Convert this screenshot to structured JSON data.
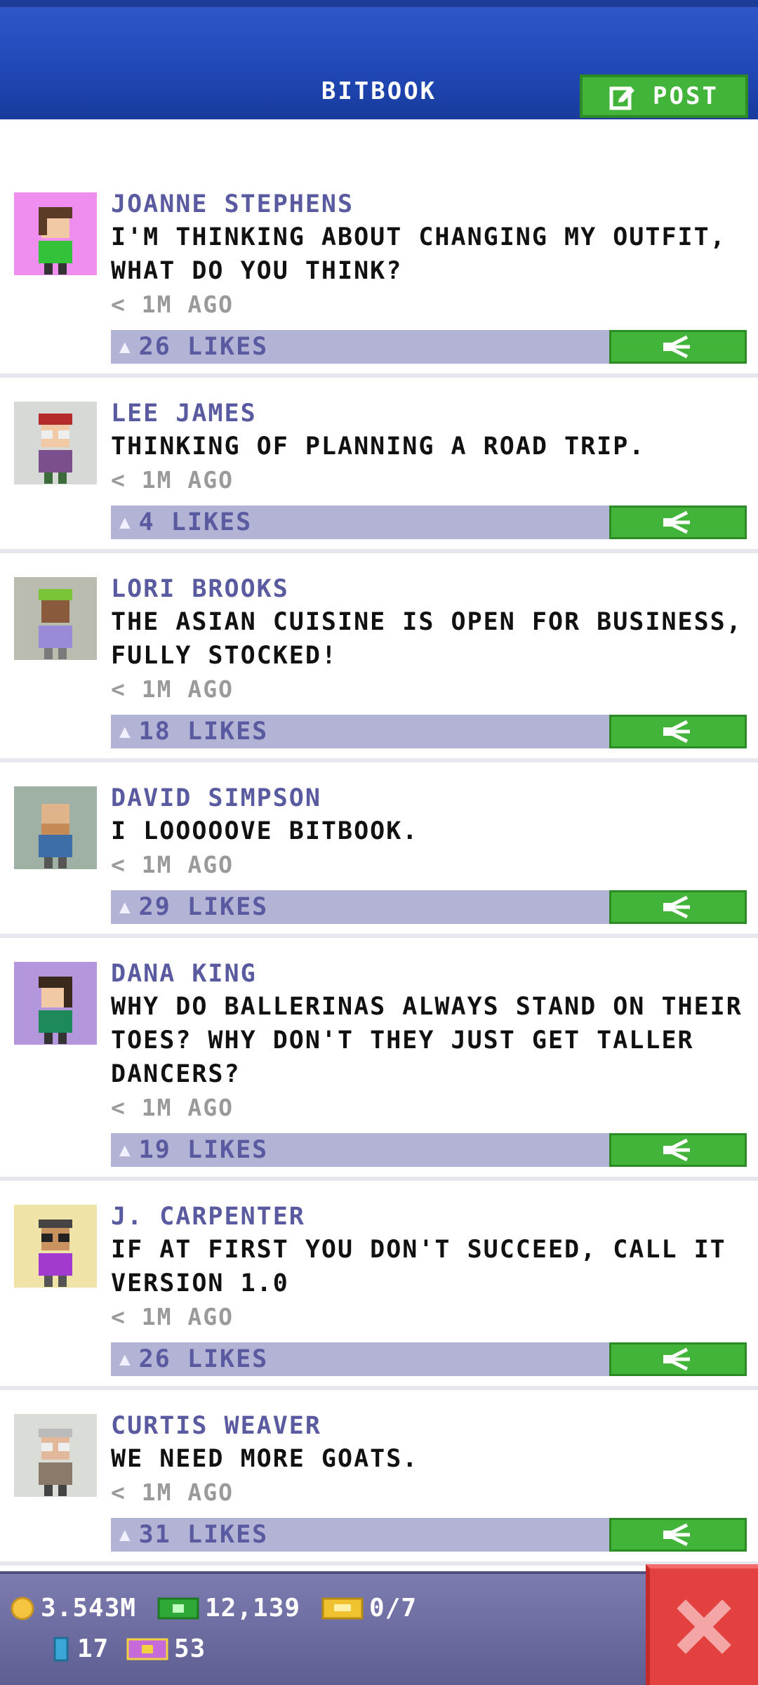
{
  "header": {
    "title": "BITBOOK",
    "post_label": "POST"
  },
  "posts": [
    {
      "name": "JOANNE STEPHENS",
      "message": "I'M THINKING ABOUT CHANGING MY OUTFIT, WHAT DO YOU THINK?",
      "time": "< 1M AGO",
      "likes": "26 LIKES"
    },
    {
      "name": "LEE JAMES",
      "message": "THINKING OF PLANNING A ROAD TRIP.",
      "time": "< 1M AGO",
      "likes": "4 LIKES"
    },
    {
      "name": "LORI BROOKS",
      "message": "THE ASIAN CUISINE IS OPEN FOR BUSINESS, FULLY STOCKED!",
      "time": "< 1M AGO",
      "likes": "18 LIKES"
    },
    {
      "name": "DAVID SIMPSON",
      "message": "I LOOOOOVE BITBOOK.",
      "time": "< 1M AGO",
      "likes": "29 LIKES"
    },
    {
      "name": "DANA KING",
      "message": "WHY DO BALLERINAS ALWAYS STAND ON THEIR TOES? WHY DON'T THEY JUST GET TALLER DANCERS?",
      "time": "< 1M AGO",
      "likes": "19 LIKES"
    },
    {
      "name": "J. CARPENTER",
      "message": "IF AT FIRST YOU DON'T SUCCEED, CALL IT VERSION 1.0",
      "time": "< 1M AGO",
      "likes": "26 LIKES"
    },
    {
      "name": "CURTIS WEAVER",
      "message": "WE NEED MORE GOATS.",
      "time": "< 1M AGO",
      "likes": "31 LIKES"
    }
  ],
  "status": {
    "coins": "3.543M",
    "bux": "12,139",
    "tickets": "0/7",
    "elevator": "17",
    "vip": "53"
  },
  "colors": {
    "header_blue": "#2148b7",
    "accent_green": "#43b43a",
    "likes_bar": "#b3b3d6",
    "name_purple": "#5a5aa0",
    "close_red": "#e34040"
  },
  "icons": {
    "post": "edit-icon",
    "share": "share-icon",
    "like": "thumb-up-icon",
    "close": "close-icon",
    "coins": "coin-icon",
    "bux": "bux-icon",
    "tickets": "ticket-icon",
    "elevator": "elevator-icon",
    "vip": "vip-icon"
  },
  "avatar_colors": [
    "#f08ef0",
    "#d6d9d6",
    "#b9bcae",
    "#9fb0a5",
    "#b396dc",
    "#efe3a8",
    "#dadcd8"
  ]
}
